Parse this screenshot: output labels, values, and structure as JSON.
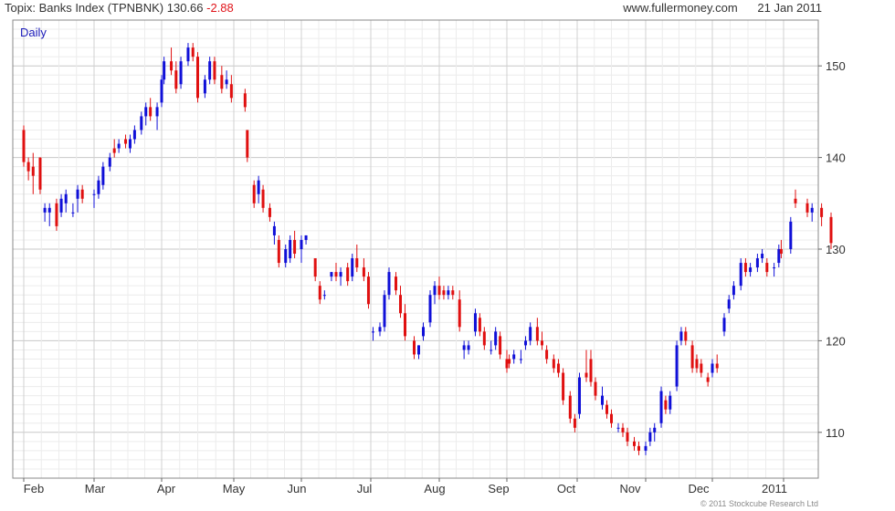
{
  "header": {
    "index_name": "Topix: Banks Index (TPNBNK)",
    "last_price": "130.66",
    "change": "-2.88",
    "site": "www.fullermoney.com",
    "date": "21 Jan 2011"
  },
  "copyright": "© 2011 Stockcube Research Ltd",
  "chart_data": {
    "type": "candlestick",
    "label": "Daily",
    "x_tick_labels": [
      "Feb",
      "Mar",
      "Apr",
      "May",
      "Jun",
      "Jul",
      "Aug",
      "Sep",
      "Oct",
      "Nov",
      "Dec",
      "2011"
    ],
    "y_ticks": [
      110,
      120,
      130,
      140,
      150
    ],
    "y_range": [
      105,
      155
    ],
    "up_color": "#1010d8",
    "down_color": "#e01010",
    "grid": true,
    "series": [
      {
        "date": "Feb 1",
        "o": 143,
        "h": 143.5,
        "l": 139,
        "c": 139.5
      },
      {
        "date": "Feb 3",
        "o": 139.5,
        "h": 140,
        "l": 137.5,
        "c": 138.5
      },
      {
        "date": "Feb 5",
        "o": 139,
        "h": 140.5,
        "l": 136,
        "c": 138
      },
      {
        "date": "Feb 8",
        "o": 140,
        "h": 140,
        "l": 136,
        "c": 136.5
      },
      {
        "date": "Feb 10",
        "o": 134,
        "h": 135,
        "l": 133,
        "c": 134.5
      },
      {
        "date": "Feb 12",
        "o": 134,
        "h": 135,
        "l": 132.5,
        "c": 134.5
      },
      {
        "date": "Feb 15",
        "o": 135,
        "h": 135.5,
        "l": 132,
        "c": 132.5
      },
      {
        "date": "Feb 17",
        "o": 134,
        "h": 136,
        "l": 133.5,
        "c": 135.5
      },
      {
        "date": "Feb 19",
        "o": 135,
        "h": 136.5,
        "l": 134,
        "c": 136
      },
      {
        "date": "Feb 22",
        "o": 134,
        "h": 135,
        "l": 133.5,
        "c": 134
      },
      {
        "date": "Feb 24",
        "o": 135.5,
        "h": 137,
        "l": 134,
        "c": 136.5
      },
      {
        "date": "Feb 26",
        "o": 136.5,
        "h": 137,
        "l": 135,
        "c": 135.5
      },
      {
        "date": "Mar 1",
        "o": 136,
        "h": 136.5,
        "l": 134.5,
        "c": 136
      },
      {
        "date": "Mar 3",
        "o": 136,
        "h": 138,
        "l": 135.5,
        "c": 137.5
      },
      {
        "date": "Mar 5",
        "o": 137,
        "h": 139.5,
        "l": 136.5,
        "c": 139
      },
      {
        "date": "Mar 8",
        "o": 139,
        "h": 140.5,
        "l": 138.5,
        "c": 140
      },
      {
        "date": "Mar 10",
        "o": 141,
        "h": 142,
        "l": 140,
        "c": 140.5
      },
      {
        "date": "Mar 12",
        "o": 141,
        "h": 142,
        "l": 140.5,
        "c": 141.5
      },
      {
        "date": "Mar 15",
        "o": 142,
        "h": 142.5,
        "l": 141,
        "c": 141.5
      },
      {
        "date": "Mar 17",
        "o": 141,
        "h": 142.5,
        "l": 140.5,
        "c": 142
      },
      {
        "date": "Mar 19",
        "o": 142,
        "h": 143.5,
        "l": 141.5,
        "c": 143
      },
      {
        "date": "Mar 22",
        "o": 143,
        "h": 145,
        "l": 142.5,
        "c": 144.5
      },
      {
        "date": "Mar 24",
        "o": 144.5,
        "h": 146,
        "l": 143.5,
        "c": 145.5
      },
      {
        "date": "Mar 26",
        "o": 145.5,
        "h": 146.5,
        "l": 144,
        "c": 144.5
      },
      {
        "date": "Mar 29",
        "o": 144.5,
        "h": 146,
        "l": 143,
        "c": 145.5
      },
      {
        "date": "Mar 31",
        "o": 146,
        "h": 149,
        "l": 145.5,
        "c": 148.5
      },
      {
        "date": "Apr 2",
        "o": 148.5,
        "h": 151,
        "l": 148,
        "c": 150.5
      },
      {
        "date": "Apr 5",
        "o": 150.5,
        "h": 152,
        "l": 149,
        "c": 149.5
      },
      {
        "date": "Apr 7",
        "o": 149.5,
        "h": 150.5,
        "l": 147,
        "c": 147.5
      },
      {
        "date": "Apr 9",
        "o": 148,
        "h": 151,
        "l": 147.5,
        "c": 150.5
      },
      {
        "date": "Apr 12",
        "o": 150.5,
        "h": 152.5,
        "l": 150,
        "c": 152
      },
      {
        "date": "Apr 14",
        "o": 152,
        "h": 152.5,
        "l": 150.5,
        "c": 151
      },
      {
        "date": "Apr 16",
        "o": 151,
        "h": 151.5,
        "l": 146,
        "c": 146.5
      },
      {
        "date": "Apr 19",
        "o": 147,
        "h": 149,
        "l": 146.5,
        "c": 148.5
      },
      {
        "date": "Apr 21",
        "o": 148.5,
        "h": 151,
        "l": 148,
        "c": 150.5
      },
      {
        "date": "Apr 23",
        "o": 150.5,
        "h": 151,
        "l": 148,
        "c": 148.5
      },
      {
        "date": "Apr 26",
        "o": 149,
        "h": 150,
        "l": 147,
        "c": 147.5
      },
      {
        "date": "Apr 28",
        "o": 148,
        "h": 149.5,
        "l": 147.5,
        "c": 148.5
      },
      {
        "date": "Apr 30",
        "o": 148,
        "h": 149,
        "l": 146,
        "c": 146.5
      },
      {
        "date": "May 6",
        "o": 147,
        "h": 147.5,
        "l": 145,
        "c": 145.5
      },
      {
        "date": "May 7",
        "o": 143,
        "h": 143,
        "l": 139.5,
        "c": 140
      },
      {
        "date": "May 10",
        "o": 137,
        "h": 137.5,
        "l": 134.5,
        "c": 135
      },
      {
        "date": "May 12",
        "o": 136,
        "h": 138,
        "l": 135,
        "c": 137.5
      },
      {
        "date": "May 14",
        "o": 136.5,
        "h": 137,
        "l": 134,
        "c": 134.5
      },
      {
        "date": "May 17",
        "o": 134.5,
        "h": 135,
        "l": 133,
        "c": 133.5
      },
      {
        "date": "May 19",
        "o": 131.5,
        "h": 133,
        "l": 130.5,
        "c": 132.5
      },
      {
        "date": "May 21",
        "o": 131,
        "h": 131.5,
        "l": 128,
        "c": 128.5
      },
      {
        "date": "May 24",
        "o": 128.5,
        "h": 130.5,
        "l": 128,
        "c": 130
      },
      {
        "date": "May 26",
        "o": 129,
        "h": 131.5,
        "l": 128.5,
        "c": 131
      },
      {
        "date": "May 28",
        "o": 131,
        "h": 132,
        "l": 129,
        "c": 129.5
      },
      {
        "date": "Jun 1",
        "o": 130,
        "h": 131.5,
        "l": 128.5,
        "c": 131
      },
      {
        "date": "Jun 3",
        "o": 131,
        "h": 131.5,
        "l": 130.5,
        "c": 131.5
      },
      {
        "date": "Jun 7",
        "o": 129,
        "h": 129,
        "l": 126.5,
        "c": 127
      },
      {
        "date": "Jun 9",
        "o": 126,
        "h": 126.5,
        "l": 124,
        "c": 124.5
      },
      {
        "date": "Jun 11",
        "o": 125,
        "h": 125.5,
        "l": 124.5,
        "c": 125
      },
      {
        "date": "Jun 14",
        "o": 127,
        "h": 127.5,
        "l": 126.5,
        "c": 127.5
      },
      {
        "date": "Jun 16",
        "o": 127.5,
        "h": 128.5,
        "l": 126.5,
        "c": 127
      },
      {
        "date": "Jun 18",
        "o": 127,
        "h": 128,
        "l": 126,
        "c": 127.5
      },
      {
        "date": "Jun 21",
        "o": 128,
        "h": 128.5,
        "l": 126,
        "c": 126.5
      },
      {
        "date": "Jun 23",
        "o": 127,
        "h": 129.5,
        "l": 126.5,
        "c": 129
      },
      {
        "date": "Jun 25",
        "o": 129,
        "h": 130.5,
        "l": 127.5,
        "c": 128
      },
      {
        "date": "Jun 28",
        "o": 128,
        "h": 129,
        "l": 126.5,
        "c": 127
      },
      {
        "date": "Jun 30",
        "o": 127,
        "h": 127.5,
        "l": 123.5,
        "c": 124
      },
      {
        "date": "Jul 2",
        "o": 121,
        "h": 121.5,
        "l": 120,
        "c": 121
      },
      {
        "date": "Jul 5",
        "o": 121,
        "h": 122,
        "l": 120.5,
        "c": 121.5
      },
      {
        "date": "Jul 7",
        "o": 121.5,
        "h": 125.5,
        "l": 121,
        "c": 125
      },
      {
        "date": "Jul 9",
        "o": 125,
        "h": 128,
        "l": 124.5,
        "c": 127.5
      },
      {
        "date": "Jul 12",
        "o": 127,
        "h": 127.5,
        "l": 125,
        "c": 125.5
      },
      {
        "date": "Jul 14",
        "o": 125,
        "h": 126,
        "l": 122.5,
        "c": 123
      },
      {
        "date": "Jul 16",
        "o": 123,
        "h": 124,
        "l": 120,
        "c": 120.5
      },
      {
        "date": "Jul 20",
        "o": 120,
        "h": 120.5,
        "l": 118,
        "c": 118.5
      },
      {
        "date": "Jul 22",
        "o": 118.5,
        "h": 119.5,
        "l": 118,
        "c": 119.5
      },
      {
        "date": "Jul 24",
        "o": 120.5,
        "h": 122,
        "l": 120,
        "c": 121.5
      },
      {
        "date": "Jul 27",
        "o": 122,
        "h": 125.5,
        "l": 121.5,
        "c": 125
      },
      {
        "date": "Jul 29",
        "o": 125,
        "h": 126.5,
        "l": 124,
        "c": 126
      },
      {
        "date": "Jul 31",
        "o": 126,
        "h": 127,
        "l": 124.5,
        "c": 125
      },
      {
        "date": "Aug 3",
        "o": 125.5,
        "h": 126,
        "l": 124.5,
        "c": 125
      },
      {
        "date": "Aug 5",
        "o": 125,
        "h": 126,
        "l": 124.5,
        "c": 125.5
      },
      {
        "date": "Aug 7",
        "o": 125.5,
        "h": 126,
        "l": 124.5,
        "c": 125
      },
      {
        "date": "Aug 10",
        "o": 124.5,
        "h": 125.5,
        "l": 121,
        "c": 121.5
      },
      {
        "date": "Aug 12",
        "o": 119,
        "h": 120,
        "l": 118,
        "c": 119.5
      },
      {
        "date": "Aug 14",
        "o": 119,
        "h": 120,
        "l": 118.5,
        "c": 119.5
      },
      {
        "date": "Aug 17",
        "o": 121,
        "h": 123.5,
        "l": 120.5,
        "c": 123
      },
      {
        "date": "Aug 19",
        "o": 122.5,
        "h": 123,
        "l": 120.5,
        "c": 121
      },
      {
        "date": "Aug 21",
        "o": 121,
        "h": 121.5,
        "l": 119,
        "c": 119.5
      },
      {
        "date": "Aug 24",
        "o": 119,
        "h": 120,
        "l": 118.5,
        "c": 119
      },
      {
        "date": "Aug 26",
        "o": 119.5,
        "h": 121.5,
        "l": 119,
        "c": 121
      },
      {
        "date": "Aug 28",
        "o": 120.5,
        "h": 121,
        "l": 118,
        "c": 118.5
      },
      {
        "date": "Aug 31",
        "o": 118,
        "h": 119,
        "l": 116.5,
        "c": 117
      },
      {
        "date": "Sep 2",
        "o": 118,
        "h": 118.5,
        "l": 117,
        "c": 117.5
      },
      {
        "date": "Sep 4",
        "o": 118,
        "h": 119,
        "l": 117.5,
        "c": 118.5
      },
      {
        "date": "Sep 7",
        "o": 118,
        "h": 119,
        "l": 117.5,
        "c": 118
      },
      {
        "date": "Sep 9",
        "o": 119.5,
        "h": 120.5,
        "l": 119,
        "c": 120
      },
      {
        "date": "Sep 11",
        "o": 120,
        "h": 122,
        "l": 119.5,
        "c": 121.5
      },
      {
        "date": "Sep 14",
        "o": 121.5,
        "h": 122.5,
        "l": 119.5,
        "c": 120
      },
      {
        "date": "Sep 16",
        "o": 120,
        "h": 121,
        "l": 119,
        "c": 119.5
      },
      {
        "date": "Sep 18",
        "o": 119,
        "h": 119.5,
        "l": 117.5,
        "c": 118
      },
      {
        "date": "Sep 21",
        "o": 118,
        "h": 118.5,
        "l": 116.5,
        "c": 117
      },
      {
        "date": "Sep 23",
        "o": 117.5,
        "h": 118,
        "l": 116,
        "c": 116.5
      },
      {
        "date": "Sep 25",
        "o": 116.5,
        "h": 117,
        "l": 113,
        "c": 113.5
      },
      {
        "date": "Sep 28",
        "o": 114,
        "h": 114.5,
        "l": 111,
        "c": 111.5
      },
      {
        "date": "Sep 30",
        "o": 111.5,
        "h": 112,
        "l": 110,
        "c": 110.5
      },
      {
        "date": "Oct 2",
        "o": 112,
        "h": 116.5,
        "l": 111.5,
        "c": 116
      },
      {
        "date": "Oct 5",
        "o": 116.5,
        "h": 119,
        "l": 115.5,
        "c": 116
      },
      {
        "date": "Oct 7",
        "o": 118,
        "h": 119,
        "l": 115,
        "c": 115.5
      },
      {
        "date": "Oct 9",
        "o": 115.5,
        "h": 116,
        "l": 113.5,
        "c": 114
      },
      {
        "date": "Oct 12",
        "o": 113,
        "h": 115,
        "l": 112.5,
        "c": 114
      },
      {
        "date": "Oct 14",
        "o": 113,
        "h": 113.5,
        "l": 111.5,
        "c": 112
      },
      {
        "date": "Oct 16",
        "o": 112,
        "h": 112.5,
        "l": 110.5,
        "c": 111
      },
      {
        "date": "Oct 19",
        "o": 110.5,
        "h": 111,
        "l": 110,
        "c": 110.5
      },
      {
        "date": "Oct 21",
        "o": 110.5,
        "h": 111,
        "l": 109.5,
        "c": 110
      },
      {
        "date": "Oct 23",
        "o": 110,
        "h": 110.5,
        "l": 108.5,
        "c": 109
      },
      {
        "date": "Oct 26",
        "o": 109,
        "h": 109.5,
        "l": 108,
        "c": 108.5
      },
      {
        "date": "Oct 28",
        "o": 108.5,
        "h": 109,
        "l": 107.5,
        "c": 108
      },
      {
        "date": "Nov 1",
        "o": 108,
        "h": 109,
        "l": 107.5,
        "c": 108.5
      },
      {
        "date": "Nov 3",
        "o": 109,
        "h": 110.5,
        "l": 108.5,
        "c": 110
      },
      {
        "date": "Nov 5",
        "o": 110,
        "h": 111,
        "l": 109,
        "c": 110.5
      },
      {
        "date": "Nov 8",
        "o": 111,
        "h": 115,
        "l": 110.5,
        "c": 114.5
      },
      {
        "date": "Nov 10",
        "o": 113.5,
        "h": 114,
        "l": 112,
        "c": 112.5
      },
      {
        "date": "Nov 12",
        "o": 112.5,
        "h": 114.5,
        "l": 112,
        "c": 114
      },
      {
        "date": "Nov 15",
        "o": 115,
        "h": 120,
        "l": 114.5,
        "c": 119.5
      },
      {
        "date": "Nov 17",
        "o": 120,
        "h": 121.5,
        "l": 119.5,
        "c": 121
      },
      {
        "date": "Nov 19",
        "o": 121,
        "h": 121.5,
        "l": 119.5,
        "c": 120
      },
      {
        "date": "Nov 22",
        "o": 119.5,
        "h": 120,
        "l": 116.5,
        "c": 117
      },
      {
        "date": "Nov 24",
        "o": 118,
        "h": 118.5,
        "l": 116.5,
        "c": 117
      },
      {
        "date": "Nov 26",
        "o": 117.5,
        "h": 118,
        "l": 116,
        "c": 116.5
      },
      {
        "date": "Nov 29",
        "o": 116,
        "h": 116.5,
        "l": 115,
        "c": 115.5
      },
      {
        "date": "Dec 1",
        "o": 116.5,
        "h": 118,
        "l": 116,
        "c": 117.5
      },
      {
        "date": "Dec 3",
        "o": 117.5,
        "h": 118.5,
        "l": 116.5,
        "c": 117
      },
      {
        "date": "Dec 6",
        "o": 121,
        "h": 123,
        "l": 120.5,
        "c": 122.5
      },
      {
        "date": "Dec 8",
        "o": 123.5,
        "h": 125,
        "l": 123,
        "c": 124.5
      },
      {
        "date": "Dec 10",
        "o": 125,
        "h": 126.5,
        "l": 124.5,
        "c": 126
      },
      {
        "date": "Dec 13",
        "o": 126,
        "h": 129,
        "l": 125.5,
        "c": 128.5
      },
      {
        "date": "Dec 15",
        "o": 128.5,
        "h": 129,
        "l": 127,
        "c": 127.5
      },
      {
        "date": "Dec 17",
        "o": 127.5,
        "h": 128.5,
        "l": 127,
        "c": 128
      },
      {
        "date": "Dec 20",
        "o": 128,
        "h": 129.5,
        "l": 127.5,
        "c": 129
      },
      {
        "date": "Dec 22",
        "o": 129,
        "h": 130,
        "l": 128.5,
        "c": 129.5
      },
      {
        "date": "Dec 24",
        "o": 128.5,
        "h": 129,
        "l": 127,
        "c": 127.5
      },
      {
        "date": "Dec 27",
        "o": 128,
        "h": 128.5,
        "l": 127,
        "c": 128
      },
      {
        "date": "Dec 29",
        "o": 128.5,
        "h": 130.5,
        "l": 128,
        "c": 130
      },
      {
        "date": "Dec 30",
        "o": 130,
        "h": 131,
        "l": 129,
        "c": 129.5
      },
      {
        "date": "Jan 4",
        "o": 130,
        "h": 133.5,
        "l": 129.5,
        "c": 133
      },
      {
        "date": "Jan 6",
        "o": 135.5,
        "h": 136.5,
        "l": 134.5,
        "c": 135
      },
      {
        "date": "Jan 11",
        "o": 135,
        "h": 135.5,
        "l": 133.5,
        "c": 134
      },
      {
        "date": "Jan 13",
        "o": 134,
        "h": 135,
        "l": 133,
        "c": 134.5
      },
      {
        "date": "Jan 17",
        "o": 134.5,
        "h": 135,
        "l": 132.5,
        "c": 133.5
      },
      {
        "date": "Jan 21",
        "o": 133.5,
        "h": 134,
        "l": 130,
        "c": 130.66
      }
    ]
  }
}
